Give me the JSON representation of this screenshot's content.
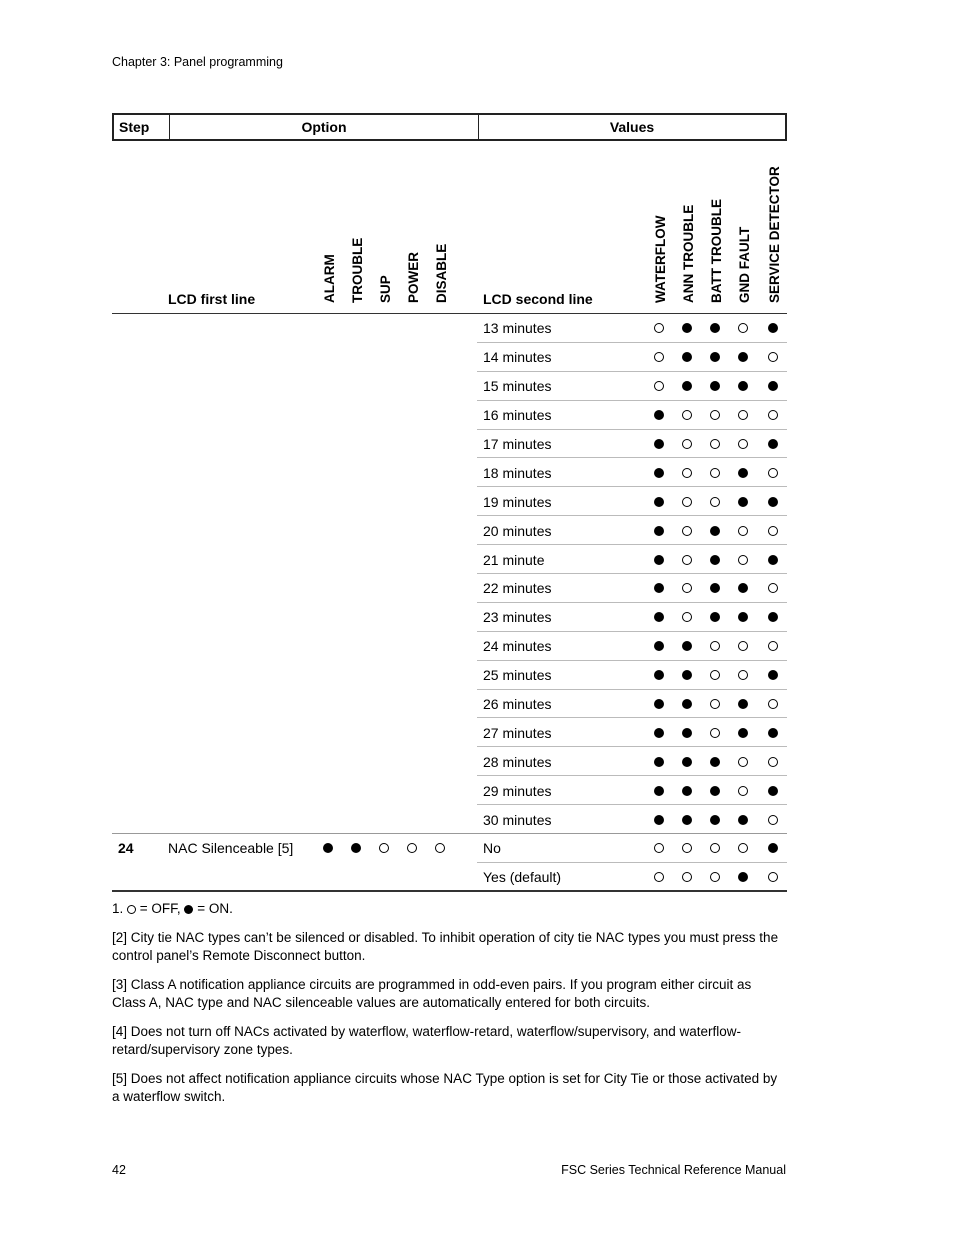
{
  "running_head": "Chapter 3: Panel programming",
  "table": {
    "headers": {
      "step": "Step",
      "option": "Option",
      "values": "Values"
    },
    "subheaders": {
      "lcd_first_line": "LCD first line",
      "option_leds": [
        "ALARM",
        "TROUBLE",
        "SUP",
        "POWER",
        "DISABLE"
      ],
      "lcd_second_line": "LCD second line",
      "value_leds": [
        "WATERFLOW",
        "ANN TROUBLE",
        "BATT TROUBLE",
        "GND FAULT",
        "SERVICE DETECTOR"
      ]
    },
    "rows": [
      {
        "step": "",
        "option": "",
        "option_leds": [],
        "value": "13 minutes",
        "value_leds": [
          0,
          1,
          1,
          0,
          1
        ]
      },
      {
        "step": "",
        "option": "",
        "option_leds": [],
        "value": "14 minutes",
        "value_leds": [
          0,
          1,
          1,
          1,
          0
        ]
      },
      {
        "step": "",
        "option": "",
        "option_leds": [],
        "value": "15 minutes",
        "value_leds": [
          0,
          1,
          1,
          1,
          1
        ]
      },
      {
        "step": "",
        "option": "",
        "option_leds": [],
        "value": "16 minutes",
        "value_leds": [
          1,
          0,
          0,
          0,
          0
        ]
      },
      {
        "step": "",
        "option": "",
        "option_leds": [],
        "value": "17 minutes",
        "value_leds": [
          1,
          0,
          0,
          0,
          1
        ]
      },
      {
        "step": "",
        "option": "",
        "option_leds": [],
        "value": "18 minutes",
        "value_leds": [
          1,
          0,
          0,
          1,
          0
        ]
      },
      {
        "step": "",
        "option": "",
        "option_leds": [],
        "value": "19 minutes",
        "value_leds": [
          1,
          0,
          0,
          1,
          1
        ]
      },
      {
        "step": "",
        "option": "",
        "option_leds": [],
        "value": "20 minutes",
        "value_leds": [
          1,
          0,
          1,
          0,
          0
        ]
      },
      {
        "step": "",
        "option": "",
        "option_leds": [],
        "value": "21 minute",
        "value_leds": [
          1,
          0,
          1,
          0,
          1
        ]
      },
      {
        "step": "",
        "option": "",
        "option_leds": [],
        "value": "22 minutes",
        "value_leds": [
          1,
          0,
          1,
          1,
          0
        ]
      },
      {
        "step": "",
        "option": "",
        "option_leds": [],
        "value": "23 minutes",
        "value_leds": [
          1,
          0,
          1,
          1,
          1
        ]
      },
      {
        "step": "",
        "option": "",
        "option_leds": [],
        "value": "24 minutes",
        "value_leds": [
          1,
          1,
          0,
          0,
          0
        ]
      },
      {
        "step": "",
        "option": "",
        "option_leds": [],
        "value": "25 minutes",
        "value_leds": [
          1,
          1,
          0,
          0,
          1
        ]
      },
      {
        "step": "",
        "option": "",
        "option_leds": [],
        "value": "26 minutes",
        "value_leds": [
          1,
          1,
          0,
          1,
          0
        ]
      },
      {
        "step": "",
        "option": "",
        "option_leds": [],
        "value": "27 minutes",
        "value_leds": [
          1,
          1,
          0,
          1,
          1
        ]
      },
      {
        "step": "",
        "option": "",
        "option_leds": [],
        "value": "28 minutes",
        "value_leds": [
          1,
          1,
          1,
          0,
          0
        ]
      },
      {
        "step": "",
        "option": "",
        "option_leds": [],
        "value": "29 minutes",
        "value_leds": [
          1,
          1,
          1,
          0,
          1
        ]
      },
      {
        "step": "",
        "option": "",
        "option_leds": [],
        "value": "30 minutes",
        "value_leds": [
          1,
          1,
          1,
          1,
          0
        ],
        "group_end": true
      },
      {
        "step": "24",
        "option": "NAC Silenceable [5]",
        "option_leds": [
          1,
          1,
          0,
          0,
          0
        ],
        "value": "No",
        "value_leds": [
          0,
          0,
          0,
          0,
          1
        ]
      },
      {
        "step": "",
        "option": "",
        "option_leds": [],
        "value": "Yes (default)",
        "value_leds": [
          0,
          0,
          0,
          1,
          0
        ],
        "table_end": true
      }
    ]
  },
  "notes": {
    "legend_prefix": "1.",
    "legend_off": "= OFF,",
    "legend_on": "= ON.",
    "items": [
      "[2] City tie NAC types can’t be silenced or disabled. To inhibit operation of city tie NAC types you must press the control panel’s Remote Disconnect button.",
      "[3] Class A notification appliance circuits are programmed in odd-even pairs. If you program either circuit as Class A, NAC type and NAC silenceable values are automatically entered for both circuits.",
      "[4] Does not turn off NACs activated by waterflow, waterflow-retard, waterflow/supervisory, and waterflow-retard/supervisory zone types.",
      "[5] Does not affect notification appliance circuits whose NAC Type option is set for City Tie or those activated by a waterflow switch."
    ]
  },
  "footer": {
    "page_number": "42",
    "manual_title": "FSC Series Technical Reference Manual"
  }
}
